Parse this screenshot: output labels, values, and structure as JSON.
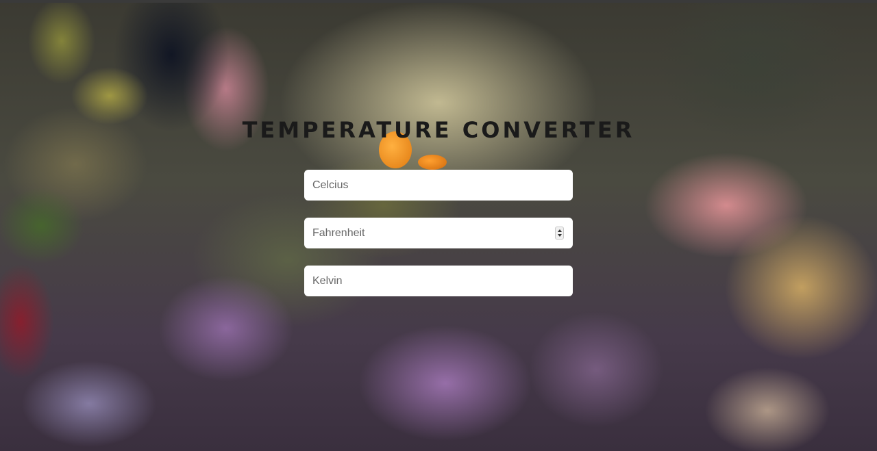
{
  "app": {
    "title": "TEMPERATURE CONVERTER"
  },
  "fields": {
    "celsius": {
      "placeholder": "Celcius",
      "value": ""
    },
    "fahrenheit": {
      "placeholder": "Fahrenheit",
      "value": ""
    },
    "kelvin": {
      "placeholder": "Kelvin",
      "value": ""
    }
  },
  "theme": {
    "title_color": "#1a1a1a",
    "field_background": "#ffffff",
    "placeholder_color": "#666666"
  },
  "icons": {
    "number_spinner": "spinner-icon"
  }
}
